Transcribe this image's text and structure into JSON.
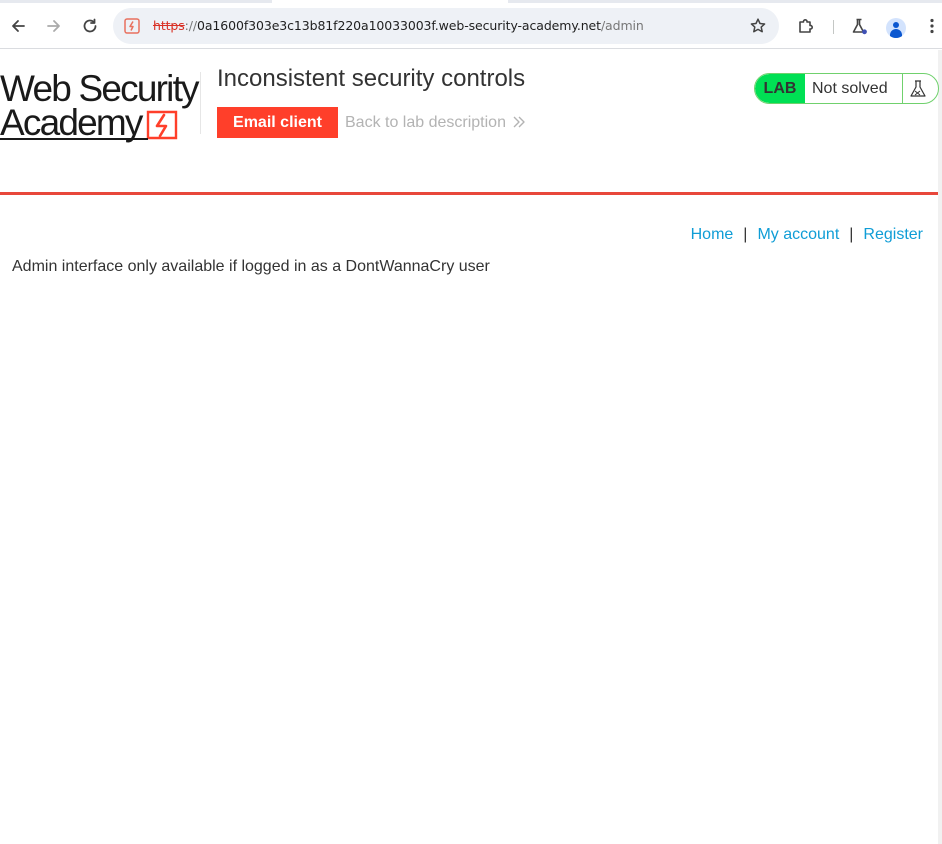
{
  "browser": {
    "url_scheme": "https",
    "url_separator": "://",
    "url_host": "0a1600f303e3c13b81f220a10033003f.web-security-academy.net",
    "url_path": "/admin"
  },
  "header": {
    "logo_line1": "Web Security",
    "logo_line2": "Academy",
    "lab_title": "Inconsistent security controls",
    "email_client_label": "Email client",
    "back_link_label": "Back to lab description"
  },
  "status": {
    "lab_label": "LAB",
    "state": "Not solved"
  },
  "nav": {
    "items": [
      {
        "label": "Home"
      },
      {
        "label": "My account"
      },
      {
        "label": "Register"
      }
    ],
    "separator": "|"
  },
  "main": {
    "message": "Admin interface only available if logged in as a DontWannaCry user"
  },
  "colors": {
    "accent": "#ff3f2a",
    "link": "#0f9dd6",
    "lab_green": "#00e054",
    "rule_red": "#e8473b"
  },
  "icons": {
    "back": "arrow-left-icon",
    "forward": "arrow-right-icon",
    "reload": "reload-icon",
    "site": "lightning-site-icon",
    "bookmark": "star-icon",
    "extensions": "puzzle-icon",
    "labs": "flask-icon",
    "profile": "avatar-icon",
    "menu": "kebab-menu-icon"
  }
}
